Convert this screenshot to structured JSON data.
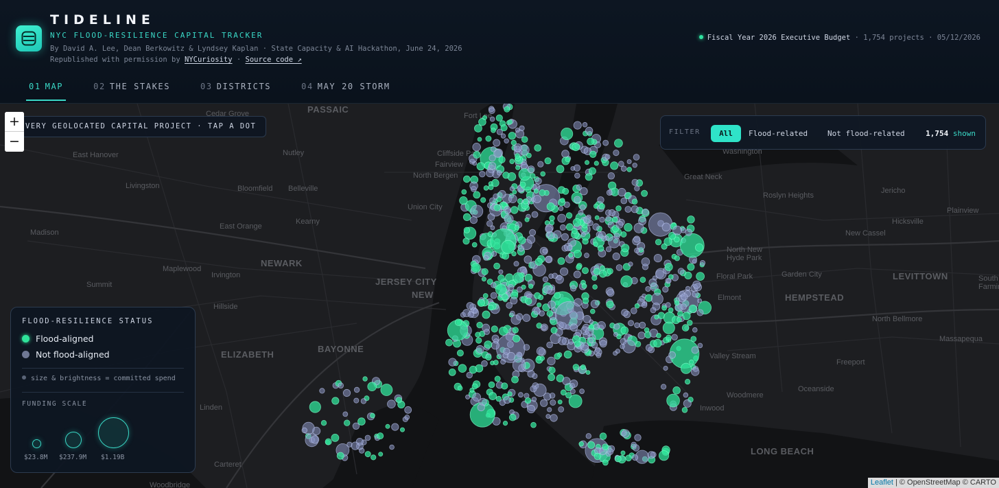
{
  "header": {
    "brand": "TIDELINE",
    "subtitle": "NYC FLOOD-RESILIENCE CAPITAL TRACKER",
    "byline": "By David A. Lee, Dean Berkowitz & Lyndsey Kaplan · State Capacity & AI Hackathon, June 24, 2026",
    "republished_prefix": "Republished with permission by",
    "republisher": "NYCuriosity",
    "sep": "·",
    "source_link": "Source code ↗",
    "budget": "Fiscal Year 2026 Executive Budget",
    "project_count": "· 1,754 projects",
    "date": "· 05/12/2026",
    "tabs": [
      {
        "num": "01",
        "label": "MAP",
        "active": true
      },
      {
        "num": "02",
        "label": "THE STAKES",
        "active": false
      },
      {
        "num": "03",
        "label": "DISTRICTS",
        "active": false
      },
      {
        "num": "04",
        "label": "MAY 20 STORM",
        "active": false
      }
    ]
  },
  "map": {
    "zoom_in": "+",
    "zoom_out": "−",
    "hint": "VERY GEOLOCATED CAPITAL PROJECT · TAP A DOT",
    "filter": {
      "label": "FILTER",
      "options": [
        "All",
        "Flood-related",
        "Not flood-related"
      ],
      "selected": "All",
      "count": "1,754",
      "count_suffix": "shown"
    },
    "places": [
      "PASSAIC",
      "Cedar Grove",
      "Fort Lee",
      "East Hanover",
      "Nutley",
      "Cliffside Park",
      "Fairview",
      "North Bergen",
      "Livingston",
      "Bloomfield",
      "Belleville",
      "Union City",
      "Kearny",
      "East Orange",
      "Madison",
      "NEWARK",
      "Maplewood",
      "Irvington",
      "JERSEY CITY",
      "NEW",
      "Summit",
      "Hillside",
      "ELIZABETH",
      "BAYONNE",
      "Linden",
      "Carteret",
      "Woodbridge",
      "Washington",
      "Great Neck",
      "Roslyn Heights",
      "Jericho",
      "Plainview",
      "Hicksville",
      "New Cassel",
      "North New Hyde Park",
      "Floral Park",
      "Garden City",
      "LEVITTOWN",
      "Elmont",
      "HEMPSTEAD",
      "North Bellmore",
      "Massapequa",
      "Valley Stream",
      "Freeport",
      "Oceanside",
      "Woodmere",
      "Inwood",
      "LONG BEACH",
      "South Farming"
    ],
    "colors": {
      "flood": "#2fe39a",
      "not_flood": "#8a95c4",
      "accent": "#3ad9c7",
      "land": "#1d1e21",
      "water": "#121315"
    },
    "attribution": {
      "leaflet": "Leaflet",
      "rest": "| © OpenStreetMap © CARTO"
    }
  },
  "legend": {
    "title": "FLOOD-RESILIENCE STATUS",
    "flood_label": "Flood-aligned",
    "not_label": "Not flood-aligned",
    "note": "size & brightness = committed spend",
    "scale_title": "FUNDING SCALE",
    "scale": [
      "$23.8M",
      "$237.9M",
      "$1.19B"
    ]
  }
}
